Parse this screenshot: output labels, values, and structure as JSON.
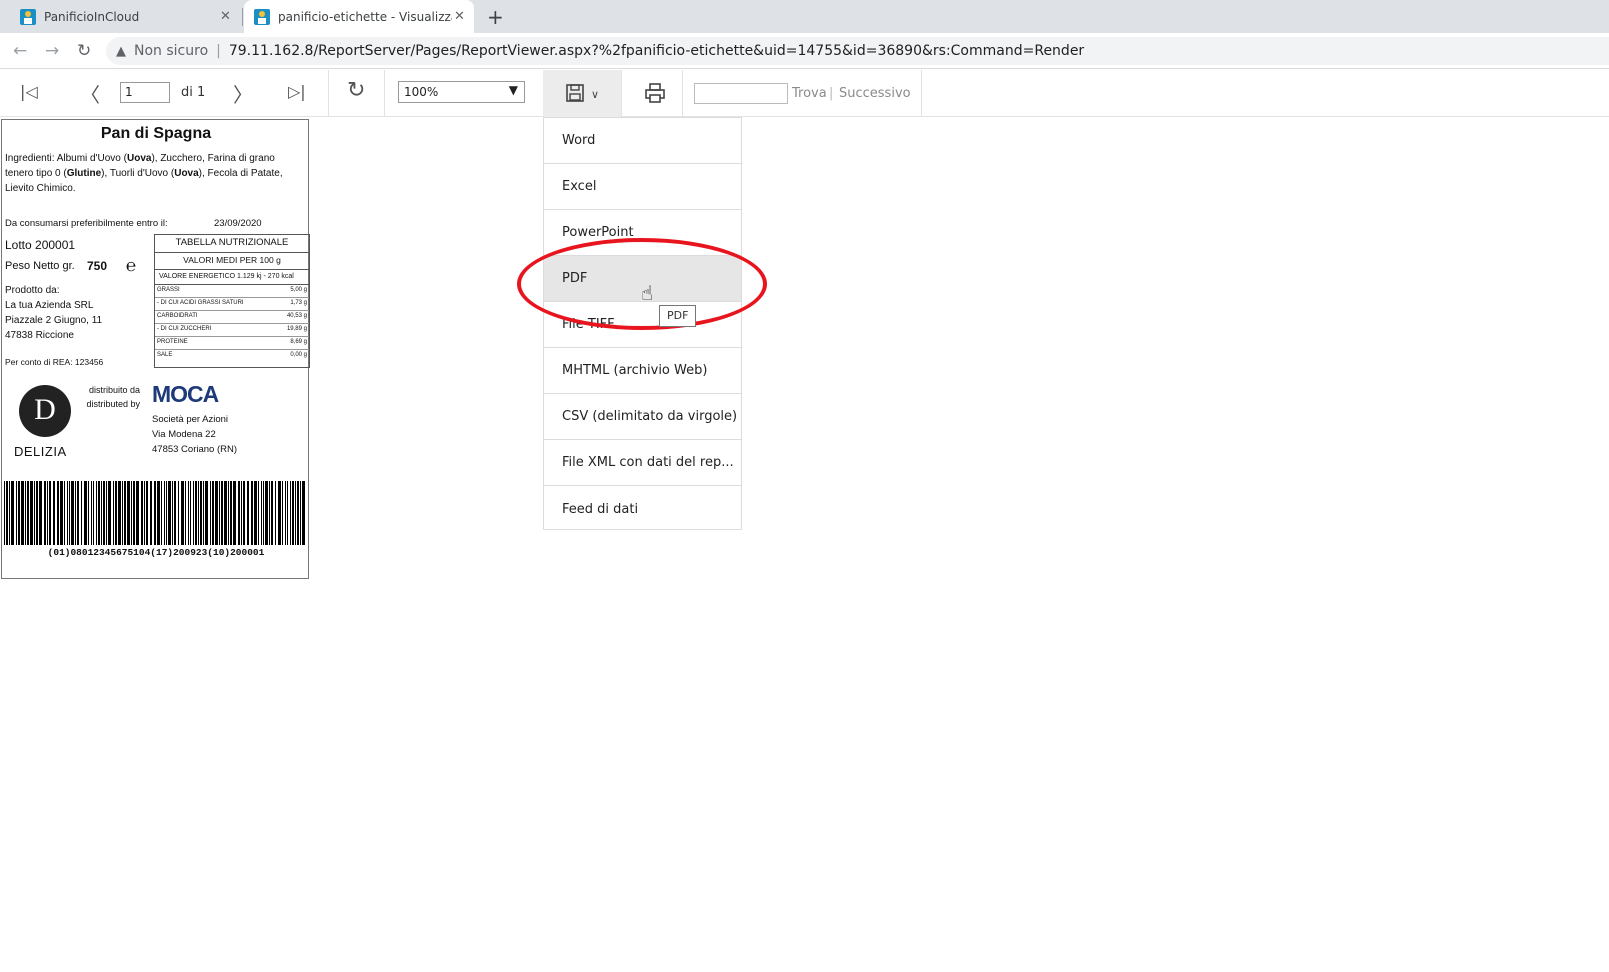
{
  "browser": {
    "tabs": [
      {
        "title": "PanificioInCloud"
      },
      {
        "title": "panificio-etichette - Visualizzatore report"
      }
    ],
    "address": {
      "security_label": "Non sicuro",
      "url": "79.11.162.8/ReportServer/Pages/ReportViewer.aspx?%2fpanificio-etichette&uid=14755&id=36890&rs:Command=Render"
    }
  },
  "toolbar": {
    "page_current": "1",
    "page_of": "di 1",
    "zoom": "100%",
    "find_label": "Trova",
    "next_label": "Successivo"
  },
  "export_menu": {
    "items": [
      "Word",
      "Excel",
      "PowerPoint",
      "PDF",
      "File TIFF",
      "MHTML (archivio Web)",
      "CSV (delimitato da virgole)",
      "File XML con dati del rep...",
      "Feed di dati"
    ],
    "hovered": "PDF",
    "tooltip": "PDF"
  },
  "label": {
    "title": "Pan di Spagna",
    "ingredients_prefix": "Ingredienti: Albumi d'Uovo (",
    "ingredients_b1": "Uova",
    "ingredients_mid1": "), Zucchero, Farina di grano tenero tipo 0 (",
    "ingredients_b2": "Glutine",
    "ingredients_mid2": "), Tuorli d'Uovo (",
    "ingredients_b3": "Uova",
    "ingredients_suffix": "), Fecola di Patate, Lievito Chimico.",
    "expiry_label": "Da consumarsi preferibilmente entro il:",
    "expiry_date": "23/09/2020",
    "lot": "Lotto 200001",
    "weight_label": "Peso Netto gr.",
    "weight_value": "750",
    "e_mark": "℮",
    "producer_label": "Prodotto da:",
    "producer_name": "La tua Azienda SRL",
    "producer_street": "Piazzale 2 Giugno, 11",
    "producer_city": "47838 Riccione",
    "rea": "Per conto di REA: 123456",
    "nutrition": {
      "title": "TABELLA NUTRIZIONALE",
      "subtitle": "VALORI MEDI PER 100 g",
      "energy": "VALORE ENERGETICO 1.129 kj - 270 kcal",
      "rows": [
        {
          "name": "GRASSI",
          "value": "5,00 g"
        },
        {
          "name": "- DI CUI ACIDI GRASSI SATURI",
          "value": "1,73 g"
        },
        {
          "name": "CARBOIDRATI",
          "value": "40,53 g"
        },
        {
          "name": "- DI CUI ZUCCHERI",
          "value": "19,89 g"
        },
        {
          "name": "PROTEINE",
          "value": "8,69 g"
        },
        {
          "name": "SALE",
          "value": "0,00 g"
        }
      ]
    },
    "brand_logo_letter": "D",
    "brand_name": "DELIZIA",
    "distributed_it": "distribuito da",
    "distributed_en": "distributed by",
    "distributor_logo": "MOCA",
    "distributor_type": "Società per Azioni",
    "distributor_street": "Via Modena 22",
    "distributor_city": "47853 Coriano (RN)",
    "barcode_text": "(01)08012345675104(17)200923(10)200001"
  }
}
